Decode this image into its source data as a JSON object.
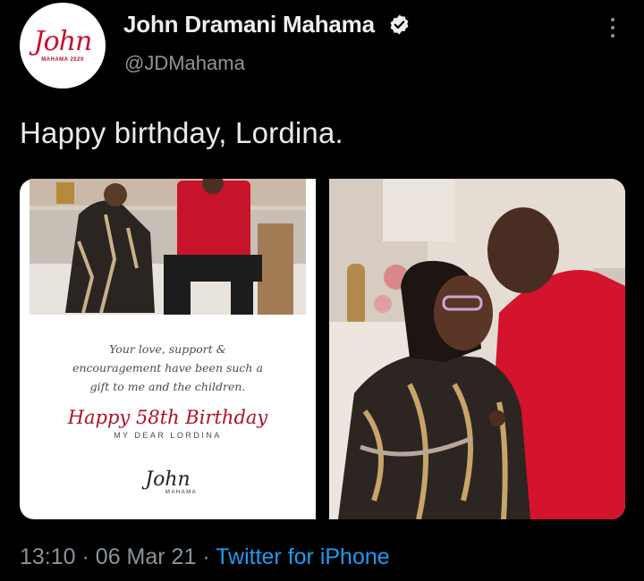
{
  "author": {
    "name": "John Dramani Mahama",
    "handle": "@JDMahama",
    "avatar_signature": "John",
    "avatar_subtitle": "MAHAMA 2020"
  },
  "tweet": {
    "text": "Happy birthday, Lordina."
  },
  "card": {
    "message_line1": "Your love, support &",
    "message_line2": "encouragement have been such a",
    "message_line3": "gift to me and the children.",
    "birthday_line": "Happy 58th Birthday",
    "dear_line": "MY DEAR LORDINA",
    "signature": "John",
    "signature_sub": "MAHAMA"
  },
  "meta": {
    "time": "13:10",
    "separator": "·",
    "date": "06 Mar 21",
    "source": "Twitter for iPhone"
  },
  "icons": {
    "verified": "verified-badge-icon",
    "more": "more-options-icon"
  },
  "colors": {
    "background": "#000000",
    "link": "#1d9bf0",
    "brand_red": "#c8102e"
  }
}
